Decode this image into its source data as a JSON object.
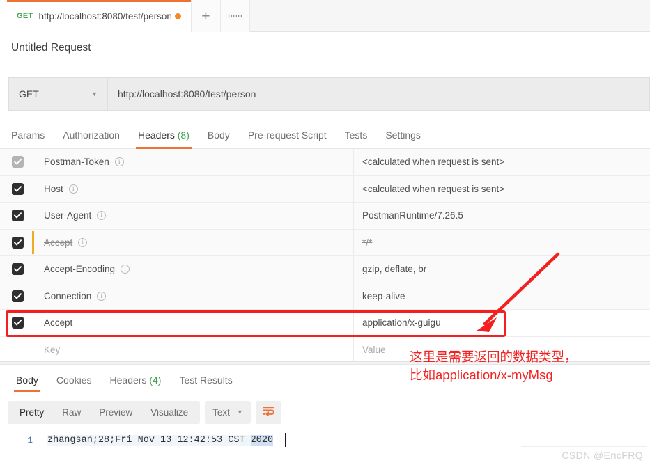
{
  "window": {
    "app": "Postman",
    "watermark": "CSDN @EricFRQ"
  },
  "tabstrip": {
    "tab": {
      "method": "GET",
      "url": "http://localhost:8080/test/person",
      "unsaved_dot": "unsaved-indicator"
    },
    "new_tab_icon": "plus-icon",
    "more_icon": "ellipsis-icon"
  },
  "request": {
    "title": "Untitled Request",
    "method": "GET",
    "method_caret_icon": "chevron-down-icon",
    "url": "http://localhost:8080/test/person"
  },
  "request_tabs": [
    {
      "label": "Params",
      "count": "",
      "active": false
    },
    {
      "label": "Authorization",
      "count": "",
      "active": false
    },
    {
      "label": "Headers",
      "count": "(8)",
      "active": true
    },
    {
      "label": "Body",
      "count": "",
      "active": false
    },
    {
      "label": "Pre-request Script",
      "count": "",
      "active": false
    },
    {
      "label": "Tests",
      "count": "",
      "active": false
    },
    {
      "label": "Settings",
      "count": "",
      "active": false
    }
  ],
  "headers_table": {
    "columns": [
      "",
      "Key",
      "Value"
    ],
    "key_placeholder": "Key",
    "value_placeholder": "Value",
    "info_icon": "info-icon",
    "rows": [
      {
        "checked": true,
        "checkbox_state": "disabled",
        "key": "Postman-Token",
        "has_info": true,
        "value": "<calculated when request is sent>",
        "value_struck": false,
        "highlighted": false,
        "marker": false
      },
      {
        "checked": true,
        "checkbox_state": "enabled",
        "key": "Host",
        "has_info": true,
        "value": "<calculated when request is sent>",
        "value_struck": false,
        "highlighted": false,
        "marker": false
      },
      {
        "checked": true,
        "checkbox_state": "enabled",
        "key": "User-Agent",
        "has_info": true,
        "value": "PostmanRuntime/7.26.5",
        "value_struck": false,
        "highlighted": false,
        "marker": false
      },
      {
        "checked": true,
        "checkbox_state": "enabled",
        "key": "Accept",
        "has_info": true,
        "value": "*/*",
        "value_struck": true,
        "key_struck": true,
        "highlighted": false,
        "marker": true
      },
      {
        "checked": true,
        "checkbox_state": "enabled",
        "key": "Accept-Encoding",
        "has_info": true,
        "value": "gzip, deflate, br",
        "value_struck": false,
        "highlighted": false,
        "marker": false
      },
      {
        "checked": true,
        "checkbox_state": "enabled",
        "key": "Connection",
        "has_info": true,
        "value": "keep-alive",
        "value_struck": false,
        "highlighted": false,
        "marker": false
      },
      {
        "checked": true,
        "checkbox_state": "enabled",
        "key": "Accept",
        "has_info": false,
        "value": "application/x-guigu",
        "value_struck": false,
        "highlighted": true,
        "marker": false
      }
    ]
  },
  "annotation": {
    "color": "#f42020",
    "text_line1": "这里是需要返回的数据类型，",
    "text_line2": "比如application/x-myMsg",
    "shapes": [
      "red-rectangle",
      "red-arrow"
    ]
  },
  "response_tabs": [
    {
      "label": "Body",
      "count": "",
      "active": true
    },
    {
      "label": "Cookies",
      "count": "",
      "active": false
    },
    {
      "label": "Headers",
      "count": "(4)",
      "active": false
    },
    {
      "label": "Test Results",
      "count": "",
      "active": false
    }
  ],
  "body_toolbar": {
    "views": [
      {
        "label": "Pretty",
        "active": true
      },
      {
        "label": "Raw",
        "active": false
      },
      {
        "label": "Preview",
        "active": false
      },
      {
        "label": "Visualize",
        "active": false
      }
    ],
    "format_select": {
      "value": "Text",
      "caret_icon": "chevron-down-icon"
    },
    "wrap_icon": "word-wrap-icon",
    "wrap_icon_color": "#ec7235"
  },
  "response_body": {
    "line_number": "1",
    "text_before_selection": "zhangsan;28;Fri Nov 13 12:42:53 CST ",
    "selected_text": "2020",
    "full_text": "zhangsan;28;Fri Nov 13 12:42:53 CST 2020"
  }
}
